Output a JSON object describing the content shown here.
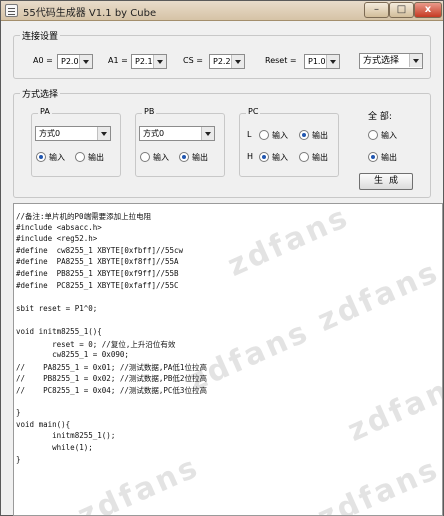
{
  "window": {
    "title": "55代码生成器 V1.1 by Cube",
    "min": "–",
    "max": "□",
    "close": "x"
  },
  "connect": {
    "legend": "连接设置",
    "a0": {
      "label": "A0 =",
      "value": "P2.0"
    },
    "a1": {
      "label": "A1 =",
      "value": "P2.1"
    },
    "cs": {
      "label": "CS =",
      "value": "P2.2"
    },
    "reset": {
      "label": "Reset =",
      "value": "P1.0"
    },
    "mode_select": "方式选择"
  },
  "mode": {
    "legend": "方式选择",
    "pa": {
      "legend": "PA",
      "combo": "方式0",
      "input": "输入",
      "output": "输出",
      "selected": "input"
    },
    "pb": {
      "legend": "PB",
      "combo": "方式0",
      "input": "输入",
      "output": "输出",
      "selected": "output"
    },
    "pc": {
      "legend": "PC",
      "l_label": "L",
      "l_input": "输入",
      "l_output": "输出",
      "l_selected": "output",
      "h_label": "H",
      "h_input": "输入",
      "h_output": "输出",
      "h_selected": "input"
    },
    "all": {
      "label": "全 部:",
      "input": "输入",
      "output": "输出",
      "selected": "output"
    },
    "generate": "生成"
  },
  "code": [
    "//备注:单片机的P0端需要添加上拉电阻",
    "#include <absacc.h>",
    "#include <reg52.h>",
    "#define  cw8255_1 XBYTE[0xfbff]//55cw",
    "#define  PA8255_1 XBYTE[0xf8ff]//55A",
    "#define  PB8255_1 XBYTE[0xf9ff]//55B",
    "#define  PC8255_1 XBYTE[0xfaff]//55C",
    "",
    "sbit reset = P1^0;",
    "",
    "void initm8255_1(){",
    "        reset = 0; //复位,上升沿位有效",
    "        cw8255_1 = 0x090;",
    "//    PA8255_1 = 0x01; //测试数据,PA低1位拉高",
    "//    PB8255_1 = 0x02; //测试数据,PB低2位拉高",
    "//    PC8255_1 = 0x04; //测试数据,PC低3位拉高",
    "",
    "}",
    "void main(){",
    "        initm8255_1();",
    "        while(1);",
    "}"
  ],
  "watermark": "zdfans"
}
